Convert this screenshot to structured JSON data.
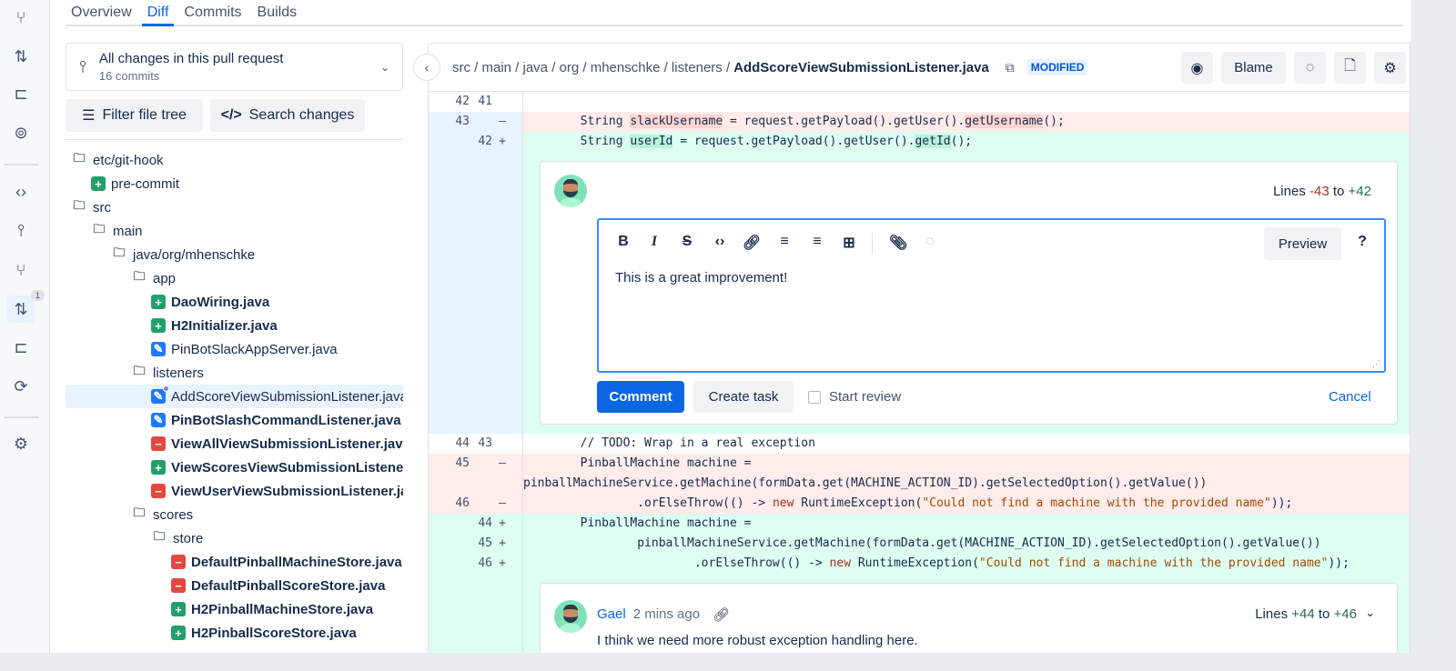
{
  "tabs": [
    {
      "label": "Overview"
    },
    {
      "label": "Diff",
      "active": true
    },
    {
      "label": "Commits"
    },
    {
      "label": "Builds"
    }
  ],
  "rail": {
    "badge": "1"
  },
  "selector": {
    "title": "All changes in this pull request",
    "subtitle": "16 commits"
  },
  "buttons": {
    "filter": "Filter file tree",
    "search": "Search changes"
  },
  "tree": [
    {
      "name": "etc/git-hook",
      "kind": "folder",
      "depth": 0
    },
    {
      "name": "pre-commit",
      "kind": "added",
      "depth": 1
    },
    {
      "name": "src",
      "kind": "folder",
      "depth": 0
    },
    {
      "name": "main",
      "kind": "folder",
      "depth": 1
    },
    {
      "name": "java/org/mhenschke",
      "kind": "folder",
      "depth": 2
    },
    {
      "name": "app",
      "kind": "folder",
      "depth": 3
    },
    {
      "name": "DaoWiring.java",
      "kind": "added",
      "depth": 4,
      "bold": true
    },
    {
      "name": "H2Initializer.java",
      "kind": "added",
      "depth": 4,
      "bold": true
    },
    {
      "name": "PinBotSlackAppServer.java",
      "kind": "modified",
      "depth": 4
    },
    {
      "name": "listeners",
      "kind": "folder",
      "depth": 3
    },
    {
      "name": "AddScoreViewSubmissionListener.java",
      "kind": "modified",
      "depth": 4,
      "selected": true
    },
    {
      "name": "PinBotSlashCommandListener.java",
      "kind": "modified",
      "depth": 4,
      "bold": true
    },
    {
      "name": "ViewAllViewSubmissionListener.java",
      "kind": "deleted",
      "depth": 4,
      "bold": true
    },
    {
      "name": "ViewScoresViewSubmissionListener.java",
      "kind": "added",
      "depth": 4,
      "bold": true
    },
    {
      "name": "ViewUserViewSubmissionListener.java",
      "kind": "deleted",
      "depth": 4,
      "bold": true
    },
    {
      "name": "scores",
      "kind": "folder",
      "depth": 3
    },
    {
      "name": "store",
      "kind": "folder",
      "depth": 4
    },
    {
      "name": "DefaultPinballMachineStore.java",
      "kind": "deleted",
      "depth": 5,
      "bold": true
    },
    {
      "name": "DefaultPinballScoreStore.java",
      "kind": "deleted",
      "depth": 5,
      "bold": true
    },
    {
      "name": "H2PinballMachineStore.java",
      "kind": "added",
      "depth": 5,
      "bold": true
    },
    {
      "name": "H2PinballScoreStore.java",
      "kind": "added",
      "depth": 5,
      "bold": true
    }
  ],
  "file": {
    "path": "src / main / java / org / mhenschke / listeners /",
    "name": "AddScoreViewSubmissionListener.java",
    "status": "MODIFIED",
    "blame": "Blame"
  },
  "code_top": [
    {
      "type": "ctx",
      "old": "42",
      "new": "41",
      "segs": []
    },
    {
      "type": "del",
      "old": "43",
      "new": "",
      "mark": "–",
      "segs": [
        [
          "t",
          "        String "
        ],
        [
          "h",
          "slackUsername"
        ],
        [
          "t",
          " = request.getPayload().getUser()."
        ],
        [
          "h",
          "getUsername"
        ],
        [
          "t",
          "();"
        ]
      ]
    },
    {
      "type": "add",
      "old": "",
      "new": "42",
      "mark": "+",
      "segs": [
        [
          "t",
          "        String "
        ],
        [
          "h",
          "userId"
        ],
        [
          "t",
          " = request.getPayload().getUser()."
        ],
        [
          "h",
          "getId"
        ],
        [
          "t",
          "();"
        ]
      ]
    }
  ],
  "new_comment": {
    "lines_label": "Lines",
    "from": "-43",
    "to_word": "to",
    "to": "+42",
    "text": "This is a great improvement!",
    "preview": "Preview",
    "help": "?",
    "comment": "Comment",
    "create_task": "Create task",
    "start_review": "Start review",
    "cancel": "Cancel"
  },
  "code_bottom": [
    {
      "type": "ctx",
      "old": "44",
      "new": "43",
      "segs": [
        [
          "t",
          "        // TODO: Wrap in a real exception"
        ]
      ]
    },
    {
      "type": "del",
      "old": "45",
      "new": "",
      "mark": "–",
      "segs": [
        [
          "t",
          "        PinballMachine machine ="
        ]
      ]
    },
    {
      "type": "del",
      "old": "",
      "new": "",
      "mark": "",
      "segs": [
        [
          "t",
          "pinballMachineService.getMachine(formData.get(MACHINE_ACTION_ID).getSelectedOption().getValue())"
        ]
      ]
    },
    {
      "type": "del",
      "old": "46",
      "new": "",
      "mark": "–",
      "segs": [
        [
          "t",
          "                .orElseThrow(() -> "
        ],
        [
          "k",
          "new"
        ],
        [
          "t",
          " RuntimeException("
        ],
        [
          "s",
          "\"Could not find a machine with the provided name\""
        ],
        [
          "t",
          "));"
        ]
      ]
    },
    {
      "type": "add",
      "old": "",
      "new": "44",
      "mark": "+",
      "segs": [
        [
          "t",
          "        PinballMachine machine ="
        ]
      ]
    },
    {
      "type": "add",
      "old": "",
      "new": "45",
      "mark": "+",
      "segs": [
        [
          "t",
          "                pinballMachineService.getMachine(formData.get(MACHINE_ACTION_ID).getSelectedOption().getValue())"
        ]
      ]
    },
    {
      "type": "add",
      "old": "",
      "new": "46",
      "mark": "+",
      "segs": [
        [
          "t",
          "                        .orElseThrow(() -> "
        ],
        [
          "k",
          "new"
        ],
        [
          "t",
          " RuntimeException("
        ],
        [
          "s",
          "\"Could not find a machine with the provided name\""
        ],
        [
          "t",
          "));"
        ]
      ]
    }
  ],
  "existing_comment": {
    "author": "Gael",
    "time": "2 mins ago",
    "lines_label": "Lines",
    "from": "+44",
    "to_word": "to",
    "to": "+46",
    "text": "I think we need more robust exception handling here."
  }
}
